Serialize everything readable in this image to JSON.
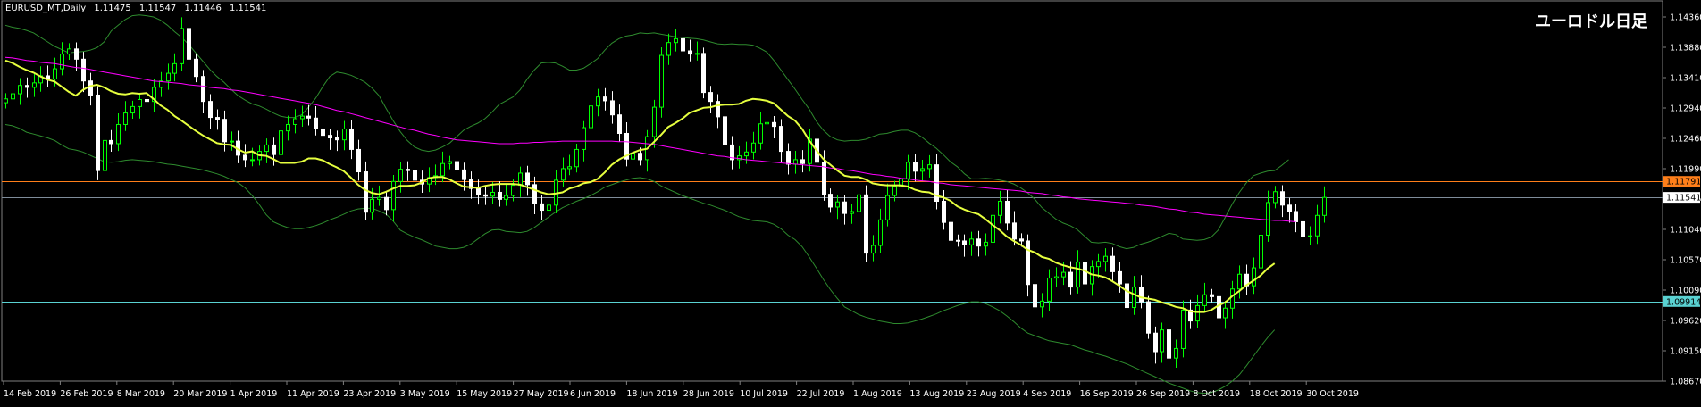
{
  "header": {
    "symbol": "EURUSD_MT,Daily",
    "ohlc": [
      "1.11475",
      "1.11547",
      "1.11446",
      "1.11541"
    ]
  },
  "chart_title": "ユーロドル日足",
  "colors": {
    "background": "#000000",
    "bull_candle": "#00ff00",
    "bear_candle": "#ffffff",
    "sma_yellow": "#e6ff3f",
    "sma_magenta": "#ff00ff",
    "bollinger": "#2e8b2e",
    "line_orange": "#ff7f1a",
    "line_cyan": "#5ad2d2",
    "line_grey": "#7f8c9a",
    "axis_text": "#ffffff"
  },
  "chart_data": {
    "type": "candlestick",
    "ylim": [
      1.0867,
      1.1436
    ],
    "y_ticks": [
      "1.14360",
      "1.13880",
      "1.13410",
      "1.12940",
      "1.12460",
      "1.11990",
      "1.11504",
      "1.11040",
      "1.10570",
      "1.10090",
      "1.09620",
      "1.09150",
      "1.08670"
    ],
    "x_tick_labels": [
      "14 Feb 2019",
      "26 Feb 2019",
      "8 Mar 2019",
      "20 Mar 2019",
      "1 Apr 2019",
      "11 Apr 2019",
      "23 Apr 2019",
      "3 May 2019",
      "15 May 2019",
      "27 May 2019",
      "6 Jun 2019",
      "18 Jun 2019",
      "28 Jun 2019",
      "10 Jul 2019",
      "22 Jul 2019",
      "1 Aug 2019",
      "13 Aug 2019",
      "23 Aug 2019",
      "4 Sep 2019",
      "16 Sep 2019",
      "26 Sep 2019",
      "8 Oct 2019",
      "18 Oct 2019",
      "30 Oct 2019"
    ],
    "horizontal_lines": [
      {
        "price": 1.11791,
        "label": "1.11791",
        "color": "orange"
      },
      {
        "price": 1.11541,
        "label": "1.11541",
        "color": "grey"
      },
      {
        "price": 1.09914,
        "label": "1.09914",
        "color": "cyan"
      }
    ],
    "closes": [
      1.1308,
      1.1316,
      1.1329,
      1.1326,
      1.1333,
      1.1344,
      1.1339,
      1.1355,
      1.1378,
      1.1386,
      1.137,
      1.1336,
      1.1314,
      1.1196,
      1.1243,
      1.1238,
      1.1268,
      1.1286,
      1.1296,
      1.1307,
      1.1304,
      1.1326,
      1.1336,
      1.1348,
      1.1363,
      1.1418,
      1.137,
      1.1343,
      1.1304,
      1.1279,
      1.1276,
      1.1241,
      1.1242,
      1.122,
      1.1213,
      1.1213,
      1.1226,
      1.1236,
      1.1221,
      1.1258,
      1.1268,
      1.1277,
      1.1281,
      1.1278,
      1.1261,
      1.1251,
      1.1247,
      1.1244,
      1.1261,
      1.1229,
      1.1194,
      1.1131,
      1.1151,
      1.1154,
      1.1135,
      1.1179,
      1.1198,
      1.1196,
      1.1181,
      1.1175,
      1.1185,
      1.1188,
      1.1207,
      1.121,
      1.1197,
      1.1182,
      1.1168,
      1.1158,
      1.1156,
      1.1162,
      1.1151,
      1.1157,
      1.1173,
      1.1192,
      1.1174,
      1.1144,
      1.1134,
      1.1142,
      1.1181,
      1.1199,
      1.1202,
      1.1229,
      1.1263,
      1.1297,
      1.1311,
      1.1305,
      1.1283,
      1.1254,
      1.1214,
      1.1223,
      1.1213,
      1.1249,
      1.1295,
      1.1376,
      1.1396,
      1.1402,
      1.1383,
      1.1378,
      1.1379,
      1.1318,
      1.1304,
      1.128,
      1.1236,
      1.1213,
      1.1219,
      1.1225,
      1.1239,
      1.1269,
      1.1271,
      1.1265,
      1.1226,
      1.1206,
      1.1213,
      1.1207,
      1.1245,
      1.1209,
      1.1159,
      1.1139,
      1.1147,
      1.1129,
      1.1132,
      1.1158,
      1.1067,
      1.1079,
      1.1119,
      1.1157,
      1.1171,
      1.1183,
      1.1209,
      1.1195,
      1.1199,
      1.1205,
      1.1148,
      1.1115,
      1.1087,
      1.1086,
      1.108,
      1.1089,
      1.1078,
      1.1084,
      1.1126,
      1.1148,
      1.1114,
      1.1089,
      1.1086,
      1.1018,
      1.0983,
      1.0992,
      1.1028,
      1.103,
      1.1037,
      1.1014,
      1.1053,
      1.1019,
      1.1046,
      1.1054,
      1.1062,
      1.1038,
      1.1019,
      1.0982,
      1.1014,
      1.0991,
      1.0942,
      1.0913,
      1.0947,
      1.0903,
      1.0918,
      1.0978,
      1.0961,
      1.0985,
      1.1002,
      1.0999,
      1.0966,
      1.0981,
      1.1011,
      1.1034,
      1.1016,
      1.1044,
      1.1095,
      1.1146,
      1.1163,
      1.1142,
      1.1132,
      1.1116,
      1.1093,
      1.1094,
      1.1126,
      1.1154
    ],
    "sma_yellow": [
      1.1368,
      1.1364,
      1.1358,
      1.1353,
      1.1349,
      1.1343,
      1.1338,
      1.1335,
      1.1327,
      1.1319,
      1.1313,
      1.1322,
      1.1328,
      1.133,
      1.1326,
      1.132,
      1.1316,
      1.1315,
      1.1317,
      1.1316,
      1.1317,
      1.1308,
      1.1298,
      1.1291,
      1.1281,
      1.1274,
      1.1266,
      1.1258,
      1.1251,
      1.1245,
      1.1239,
      1.1237,
      1.1236,
      1.1229,
      1.1224,
      1.1226,
      1.122,
      1.1219,
      1.1214,
      1.1208,
      1.1208,
      1.1208,
      1.121,
      1.1215,
      1.1215,
      1.1212,
      1.1206,
      1.1201,
      1.1195,
      1.1185,
      1.1174,
      1.1166,
      1.1161,
      1.1159,
      1.1163,
      1.1168,
      1.1172,
      1.1172,
      1.1173,
      1.1177,
      1.1184,
      1.1186,
      1.1186,
      1.1182,
      1.1176,
      1.1171,
      1.117,
      1.1169,
      1.1172,
      1.1174,
      1.1175,
      1.1175,
      1.1175,
      1.1174,
      1.117,
      1.1166,
      1.1162,
      1.1159,
      1.116,
      1.1162,
      1.1168,
      1.1171,
      1.1176,
      1.1178,
      1.1183,
      1.1193,
      1.1205,
      1.1213,
      1.1219,
      1.1224,
      1.1228,
      1.123,
      1.1241,
      1.1252,
      1.1264,
      1.127,
      1.1277,
      1.1286,
      1.129,
      1.1294,
      1.1295,
      1.1298,
      1.1299,
      1.1299,
      1.13,
      1.1305,
      1.1308,
      1.1307,
      1.1305,
      1.1301,
      1.1291,
      1.1281,
      1.1274,
      1.1261,
      1.1243,
      1.1228,
      1.1214,
      1.1205,
      1.1196,
      1.1188,
      1.1186,
      1.1186,
      1.1182,
      1.1176,
      1.1174,
      1.1173,
      1.1173,
      1.1173,
      1.1171,
      1.1166,
      1.1163,
      1.1162,
      1.1157,
      1.1154,
      1.1149,
      1.114,
      1.1135,
      1.1131,
      1.1128,
      1.112,
      1.1111,
      1.1103,
      1.1093,
      1.1086,
      1.108,
      1.1072,
      1.1068,
      1.1061,
      1.1058,
      1.1052,
      1.1048,
      1.1045,
      1.1043,
      1.104,
      1.1034,
      1.1032,
      1.1029,
      1.1023,
      1.1016,
      1.1008,
      1.1003,
      1.0998,
      1.0996,
      1.0994,
      1.099,
      1.0987,
      1.0983,
      1.0981,
      1.0976,
      1.0975,
      1.0975,
      1.0978,
      1.0985,
      1.099,
      1.1,
      1.1008,
      1.1017,
      1.1024,
      1.1032,
      1.1043,
      1.1051
    ],
    "sma_magenta": [
      1.1373,
      1.1372,
      1.137,
      1.1368,
      1.1367,
      1.1365,
      1.1364,
      1.1363,
      1.1361,
      1.1359,
      1.1357,
      1.1356,
      1.1354,
      1.1352,
      1.135,
      1.1348,
      1.1346,
      1.1344,
      1.1342,
      1.134,
      1.1338,
      1.1336,
      1.1335,
      1.1334,
      1.1333,
      1.1332,
      1.133,
      1.1329,
      1.1328,
      1.1326,
      1.1325,
      1.1324,
      1.1322,
      1.1321,
      1.1319,
      1.1317,
      1.1315,
      1.1313,
      1.1311,
      1.1309,
      1.1307,
      1.1305,
      1.1303,
      1.1301,
      1.1299,
      1.1296,
      1.1293,
      1.129,
      1.1288,
      1.1285,
      1.1282,
      1.1279,
      1.1276,
      1.1273,
      1.127,
      1.1267,
      1.1264,
      1.1261,
      1.1259,
      1.1256,
      1.1253,
      1.1251,
      1.1248,
      1.1246,
      1.1244,
      1.1243,
      1.1242,
      1.1241,
      1.124,
      1.1239,
      1.1238,
      1.1238,
      1.1238,
      1.1239,
      1.1239,
      1.124,
      1.124,
      1.1241,
      1.1241,
      1.1242,
      1.1242,
      1.1242,
      1.1242,
      1.1242,
      1.1242,
      1.1242,
      1.1242,
      1.1241,
      1.1241,
      1.124,
      1.1239,
      1.1238,
      1.1237,
      1.1235,
      1.1233,
      1.1231,
      1.1229,
      1.1227,
      1.1225,
      1.1223,
      1.1221,
      1.1219,
      1.1218,
      1.1216,
      1.1215,
      1.1213,
      1.1212,
      1.1211,
      1.121,
      1.1209,
      1.1208,
      1.1207,
      1.1206,
      1.1205,
      1.1204,
      1.1203,
      1.1202,
      1.12,
      1.1199,
      1.1197,
      1.1196,
      1.1194,
      1.1192,
      1.119,
      1.1189,
      1.1187,
      1.1186,
      1.1184,
      1.1183,
      1.1181,
      1.118,
      1.1179,
      1.1177,
      1.1176,
      1.1174,
      1.1173,
      1.1172,
      1.1171,
      1.117,
      1.1169,
      1.1168,
      1.1167,
      1.1166,
      1.1165,
      1.1164,
      1.1162,
      1.1161,
      1.116,
      1.1158,
      1.1157,
      1.1155,
      1.1154,
      1.1152,
      1.1151,
      1.115,
      1.1149,
      1.1148,
      1.1147,
      1.1146,
      1.1145,
      1.1144,
      1.1142,
      1.1141,
      1.114,
      1.1138,
      1.1136,
      1.1135,
      1.1133,
      1.1131,
      1.113,
      1.1128,
      1.1127,
      1.1126,
      1.1125,
      1.1124,
      1.1123,
      1.1122,
      1.1121,
      1.112,
      1.1119,
      1.1118,
      1.1118,
      1.1117,
      1.1116
    ],
    "bb_upper": [
      1.1423,
      1.142,
      1.1418,
      1.1415,
      1.1411,
      1.1404,
      1.1397,
      1.139,
      1.1385,
      1.138,
      1.1381,
      1.1382,
      1.1384,
      1.1388,
      1.1397,
      1.1414,
      1.1423,
      1.1432,
      1.1438,
      1.1439,
      1.1438,
      1.1436,
      1.1431,
      1.1423,
      1.1413,
      1.1404,
      1.1393,
      1.138,
      1.1367,
      1.1354,
      1.1343,
      1.1334,
      1.1323,
      1.1313,
      1.1306,
      1.13,
      1.1297,
      1.1292,
      1.1286,
      1.1281,
      1.1279,
      1.1279,
      1.1283,
      1.1295,
      1.1309,
      1.1327,
      1.1343,
      1.135,
      1.1348,
      1.1345,
      1.134,
      1.1334,
      1.1325,
      1.1313,
      1.1293,
      1.1274,
      1.1257,
      1.1243,
      1.1233,
      1.1228,
      1.1226,
      1.1228,
      1.1233,
      1.1239,
      1.1249,
      1.1259,
      1.1265,
      1.127,
      1.1277,
      1.1287,
      1.1299,
      1.1305,
      1.1311,
      1.1322,
      1.1339,
      1.1353,
      1.1364,
      1.1365,
      1.1364,
      1.1359,
      1.1353,
      1.1353,
      1.1356,
      1.1363,
      1.1371,
      1.1384,
      1.1395,
      1.1402,
      1.1406,
      1.1408,
      1.1411,
      1.141,
      1.1411,
      1.1409,
      1.1407,
      1.1405,
      1.1404,
      1.1403,
      1.1402,
      1.14,
      1.1397,
      1.1394,
      1.1393,
      1.1394,
      1.1393,
      1.1393,
      1.1392,
      1.1387,
      1.1381,
      1.1368,
      1.1353,
      1.1338,
      1.1323,
      1.1307,
      1.1292,
      1.1273,
      1.1259,
      1.1249,
      1.1244,
      1.1242,
      1.1243,
      1.1243,
      1.1245,
      1.1249,
      1.1253,
      1.1254,
      1.1257,
      1.1259,
      1.1259,
      1.1255,
      1.1248,
      1.1239,
      1.1231,
      1.1221,
      1.121,
      1.1202,
      1.1191,
      1.1183,
      1.1183,
      1.1184,
      1.1183,
      1.1181,
      1.1179,
      1.1175,
      1.1169,
      1.1161,
      1.1151,
      1.1138,
      1.1129,
      1.112,
      1.1114,
      1.111,
      1.1104,
      1.1094,
      1.1084,
      1.1083,
      1.1084,
      1.1082,
      1.1077,
      1.1074,
      1.1076,
      1.1081,
      1.1084,
      1.1088,
      1.1093,
      1.1098,
      1.1096,
      1.1089,
      1.1088,
      1.1087,
      1.1088,
      1.1092,
      1.1103,
      1.1123,
      1.1144,
      1.1162,
      1.1177,
      1.1188,
      1.1192,
      1.1195,
      1.1196,
      1.1204,
      1.1213
    ],
    "bb_lower": [
      1.1268,
      1.1266,
      1.1262,
      1.1256,
      1.1253,
      1.125,
      1.1247,
      1.1243,
      1.1236,
      1.123,
      1.1228,
      1.1225,
      1.122,
      1.1215,
      1.121,
      1.1209,
      1.121,
      1.1212,
      1.1213,
      1.1212,
      1.1211,
      1.121,
      1.1208,
      1.1206,
      1.1205,
      1.1203,
      1.1201,
      1.1199,
      1.1197,
      1.1194,
      1.1191,
      1.1187,
      1.1182,
      1.1177,
      1.1169,
      1.1157,
      1.1143,
      1.1127,
      1.1116,
      1.1111,
      1.1107,
      1.1105,
      1.1105,
      1.1107,
      1.111,
      1.1114,
      1.1119,
      1.1123,
      1.1128,
      1.1133,
      1.1136,
      1.1137,
      1.1137,
      1.1133,
      1.1128,
      1.1117,
      1.1103,
      1.1097,
      1.1092,
      1.1088,
      1.1083,
      1.1078,
      1.1076,
      1.1074,
      1.1074,
      1.1076,
      1.1081,
      1.1089,
      1.1097,
      1.1103,
      1.1104,
      1.1101,
      1.11,
      1.1099,
      1.1101,
      1.1107,
      1.1115,
      1.1123,
      1.1131,
      1.1138,
      1.1143,
      1.1148,
      1.1152,
      1.1157,
      1.1163,
      1.117,
      1.1174,
      1.1178,
      1.1181,
      1.1184,
      1.1185,
      1.1183,
      1.1179,
      1.1172,
      1.1167,
      1.1162,
      1.1157,
      1.1153,
      1.1149,
      1.1145,
      1.1142,
      1.1138,
      1.1134,
      1.1129,
      1.1124,
      1.1121,
      1.1118,
      1.1117,
      1.1116,
      1.1112,
      1.1105,
      1.1095,
      1.1088,
      1.1077,
      1.1061,
      1.1044,
      1.1026,
      1.101,
      1.0996,
      1.0983,
      1.0977,
      1.0971,
      1.0967,
      1.0964,
      1.0961,
      1.0959,
      1.0957,
      1.0957,
      1.0958,
      1.0961,
      1.0964,
      1.0968,
      1.0972,
      1.0977,
      1.0981,
      1.0985,
      1.0988,
      1.0991,
      1.0991,
      1.0988,
      1.0983,
      1.0977,
      1.0969,
      1.096,
      1.095,
      1.0942,
      1.0938,
      1.0934,
      1.093,
      1.0928,
      1.0926,
      1.0924,
      1.092,
      1.0916,
      1.0913,
      1.0909,
      1.0906,
      1.0902,
      1.0898,
      1.0894,
      1.0889,
      1.0884,
      1.0879,
      1.0874,
      1.0869,
      1.0864,
      1.086,
      1.0856,
      1.0852,
      1.0849,
      1.0848,
      1.0849,
      1.0853,
      1.0859,
      1.0867,
      1.0877,
      1.0891,
      1.0906,
      1.0921,
      1.0935,
      1.0947
    ]
  }
}
